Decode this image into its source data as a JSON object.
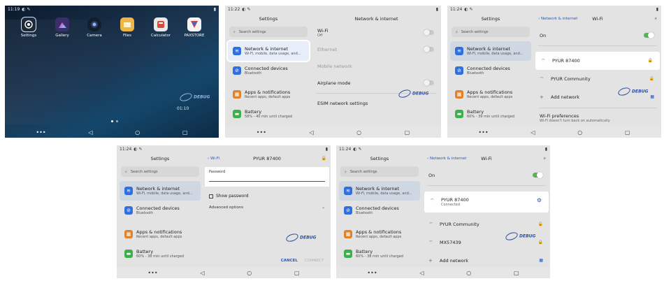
{
  "home": {
    "time": "11:19",
    "apps": [
      {
        "label": "Settings",
        "icon": "settings-icon"
      },
      {
        "label": "Gallery",
        "icon": "gallery-icon"
      },
      {
        "label": "Camera",
        "icon": "camera-icon"
      },
      {
        "label": "Files",
        "icon": "files-icon"
      },
      {
        "label": "Calculator",
        "icon": "calculator-icon"
      },
      {
        "label": "PAXSTORE",
        "icon": "paxstore-icon"
      }
    ],
    "clock": "01:10"
  },
  "settings": {
    "title": "Settings",
    "search_placeholder": "Search settings",
    "items": [
      {
        "title": "Network & internet",
        "sub": "Wi-Fi, mobile, data usage, and...",
        "color": "#2f6fe0"
      },
      {
        "title": "Connected devices",
        "sub": "Bluetooth",
        "color": "#2f6fe0"
      },
      {
        "title": "Apps & notifications",
        "sub": "Recent apps, default apps",
        "color": "#e0822a"
      },
      {
        "title": "Battery",
        "sub_p2": "58% - 40 min until charged",
        "sub_p3": "60% - 39 min until charged",
        "sub_p4": "60% - 38 min until charged",
        "sub_p5": "60% - 38 min until charged",
        "color": "#3bb14a"
      }
    ]
  },
  "panel2": {
    "time": "11:22",
    "header": "Network & internet",
    "wifi": {
      "title": "Wi-Fi",
      "sub": "Off"
    },
    "ethernet": "Ethernet",
    "mobile": "Mobile network",
    "airplane": "Airplane mode",
    "esim": "ESIM network settings"
  },
  "panel3": {
    "time": "11:24",
    "back": "Network & internet",
    "header": "Wi-Fi",
    "on_label": "On",
    "networks": [
      "PYUR 87400",
      "PYUR Community"
    ],
    "add_network": "Add network",
    "prefs_title": "Wi-Fi preferences",
    "prefs_sub": "Wi-Fi doesn't turn back on automatically"
  },
  "panel4": {
    "time": "11:24",
    "back": "Wi-Fi",
    "header": "PYUR 87400",
    "password_label": "Password",
    "show_password": "Show password",
    "advanced": "Advanced options",
    "cancel": "CANCEL",
    "connect": "CONNECT"
  },
  "panel5": {
    "time": "11:24",
    "back": "Network & internet",
    "header": "Wi-Fi",
    "on_label": "On",
    "connected_network": "PYUR 87400",
    "connected_status": "Connected",
    "networks": [
      "PYUR Community",
      "MX57439"
    ],
    "add_network": "Add network"
  },
  "watermark": "DEBUG"
}
